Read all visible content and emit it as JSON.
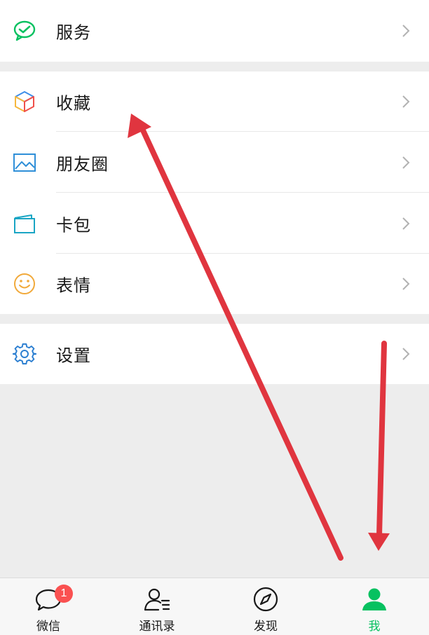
{
  "menu": {
    "services": {
      "label": "服务",
      "icon": "wechat-pay-check-icon"
    },
    "group2": [
      {
        "label": "收藏",
        "icon": "cube-favorites-icon"
      },
      {
        "label": "朋友圈",
        "icon": "moments-picture-icon"
      },
      {
        "label": "卡包",
        "icon": "card-wallet-icon"
      },
      {
        "label": "表情",
        "icon": "smiley-face-icon"
      }
    ],
    "settings": {
      "label": "设置",
      "icon": "gear-icon"
    }
  },
  "tabbar": {
    "tabs": [
      {
        "label": "微信",
        "icon": "chat-bubble-icon",
        "badge": "1"
      },
      {
        "label": "通讯录",
        "icon": "contacts-icon"
      },
      {
        "label": "发现",
        "icon": "compass-icon"
      },
      {
        "label": "我",
        "icon": "person-icon",
        "active": true
      }
    ]
  },
  "colors": {
    "accent_green": "#07c160",
    "badge_red": "#fa5151",
    "annotation_arrow": "#e0353f",
    "page_background": "#ededed"
  }
}
